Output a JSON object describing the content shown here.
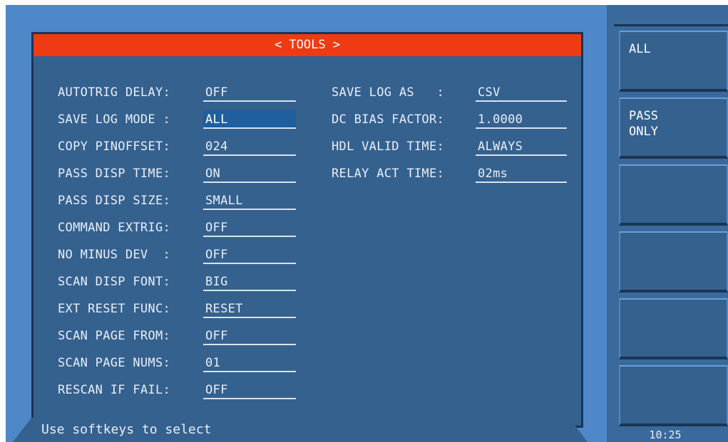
{
  "title": "< TOOLS >",
  "left_fields": [
    {
      "label": "AUTOTRIG DELAY:",
      "value": "OFF"
    },
    {
      "label": "SAVE LOG MODE :",
      "value": "ALL"
    },
    {
      "label": "COPY PINOFFSET:",
      "value": "024"
    },
    {
      "label": "PASS DISP TIME:",
      "value": "ON"
    },
    {
      "label": "PASS DISP SIZE:",
      "value": "SMALL"
    },
    {
      "label": "COMMAND EXTRIG:",
      "value": "OFF"
    },
    {
      "label": "NO MINUS DEV  :",
      "value": "OFF"
    },
    {
      "label": "SCAN DISP FONT:",
      "value": "BIG"
    },
    {
      "label": "EXT RESET FUNC:",
      "value": "RESET"
    },
    {
      "label": "SCAN PAGE FROM:",
      "value": "OFF"
    },
    {
      "label": "SCAN PAGE NUMS:",
      "value": "01"
    },
    {
      "label": "RESCAN IF FAIL:",
      "value": "OFF"
    }
  ],
  "right_fields": [
    {
      "label": "SAVE LOG AS   :",
      "value": "CSV"
    },
    {
      "label": "DC BIAS FACTOR:",
      "value": "1.0000"
    },
    {
      "label": "HDL VALID TIME:",
      "value": "ALWAYS"
    },
    {
      "label": "RELAY ACT TIME:",
      "value": "02ms"
    }
  ],
  "status_text": "Use softkeys to select",
  "softkeys": [
    "ALL",
    "PASS\nONLY",
    "",
    "",
    "",
    ""
  ],
  "clock": "10:25",
  "colors": {
    "title_bar": "#ee3b14",
    "panel": "#35618f",
    "frame": "#4e88c8",
    "selected": "#1f5fa0"
  }
}
